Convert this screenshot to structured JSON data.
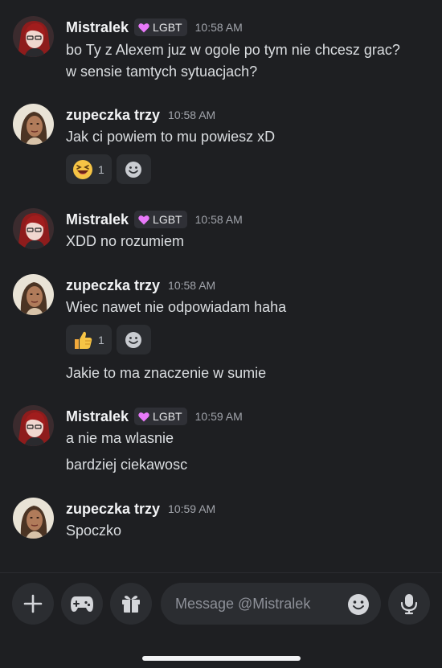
{
  "app": "Discord",
  "users": {
    "mistralek": {
      "name": "Mistralek",
      "role": "LGBT",
      "role_color": "#e879f9"
    },
    "zupeczka": {
      "name": "zupeczka trzy"
    }
  },
  "messages": [
    {
      "user": "Mistralek",
      "role": "LGBT",
      "time": "10:58 AM",
      "lines": [
        "bo Ty z Alexem juz w ogole po tym nie chcesz grac?",
        "w sensie tamtych sytuacjach?"
      ]
    },
    {
      "user": "zupeczka trzy",
      "time": "10:58 AM",
      "lines": [
        "Jak ci powiem to mu powiesz xD"
      ],
      "reaction": {
        "emoji": "laughing-face",
        "count": "1"
      }
    },
    {
      "user": "Mistralek",
      "role": "LGBT",
      "time": "10:58 AM",
      "lines": [
        "XDD no rozumiem"
      ]
    },
    {
      "user": "zupeczka trzy",
      "time": "10:58 AM",
      "lines": [
        "Wiec nawet nie odpowiadam haha",
        "Jakie to ma znaczenie w sumie"
      ],
      "reaction": {
        "emoji": "thumbs-up",
        "count": "1"
      }
    },
    {
      "user": "Mistralek",
      "role": "LGBT",
      "time": "10:59 AM",
      "lines": [
        "a nie ma wlasnie",
        "bardziej ciekawosc"
      ]
    },
    {
      "user": "zupeczka trzy",
      "time": "10:59 AM",
      "lines": [
        "Spoczko"
      ]
    }
  ],
  "composer": {
    "placeholder": "Message @Mistralek",
    "value": "",
    "icons": [
      "plus-icon",
      "gamepad-icon",
      "gift-icon",
      "emoji-icon",
      "microphone-icon"
    ]
  },
  "colors": {
    "background": "#1e1f22",
    "surface": "#2b2d31",
    "text": "#dbdee1",
    "muted": "#a1a4ab"
  }
}
